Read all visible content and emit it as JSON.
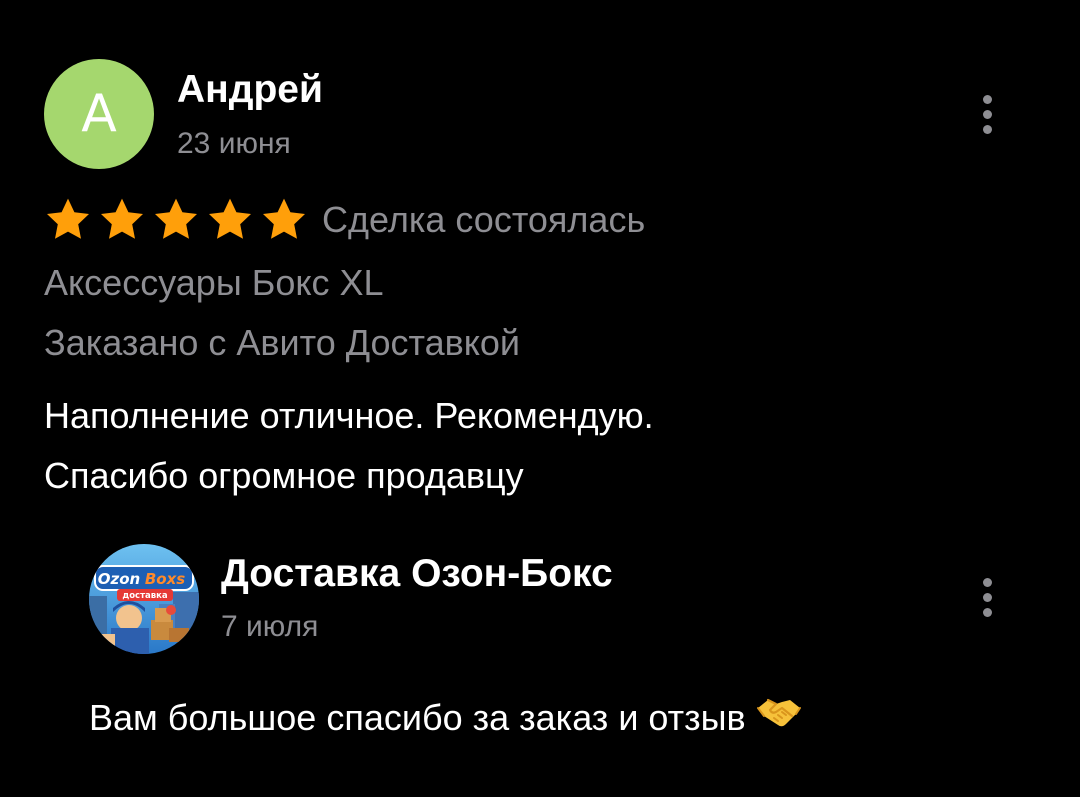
{
  "review": {
    "avatar_letter": "А",
    "avatar_color": "#a5d76e",
    "author_name": "Андрей",
    "date": "23 июня",
    "rating": 5,
    "rating_max": 5,
    "star_color": "#ff9f0a",
    "deal_status": "Сделка состоялась",
    "product": "Аксессуары Бокс XL",
    "delivery_note": "Заказано с Авито Доставкой",
    "text_lines": [
      "Наполнение отличное. Рекомендую.",
      "Спасибо огромное продавцу"
    ],
    "more_icon": "more-vertical-icon"
  },
  "reply": {
    "logo_text_1": "Ozon",
    "logo_text_2": "Boxs",
    "logo_subtitle": "доставка",
    "seller_name": "Доставка Озон-Бокс",
    "date": "7 июля",
    "text": "Вам большое спасибо за заказ и отзыв",
    "emoji_icon": "handshake-icon",
    "more_icon": "more-vertical-icon"
  },
  "colors": {
    "background": "#000000",
    "primary_text": "#ffffff",
    "secondary_text": "#8e8e93"
  }
}
